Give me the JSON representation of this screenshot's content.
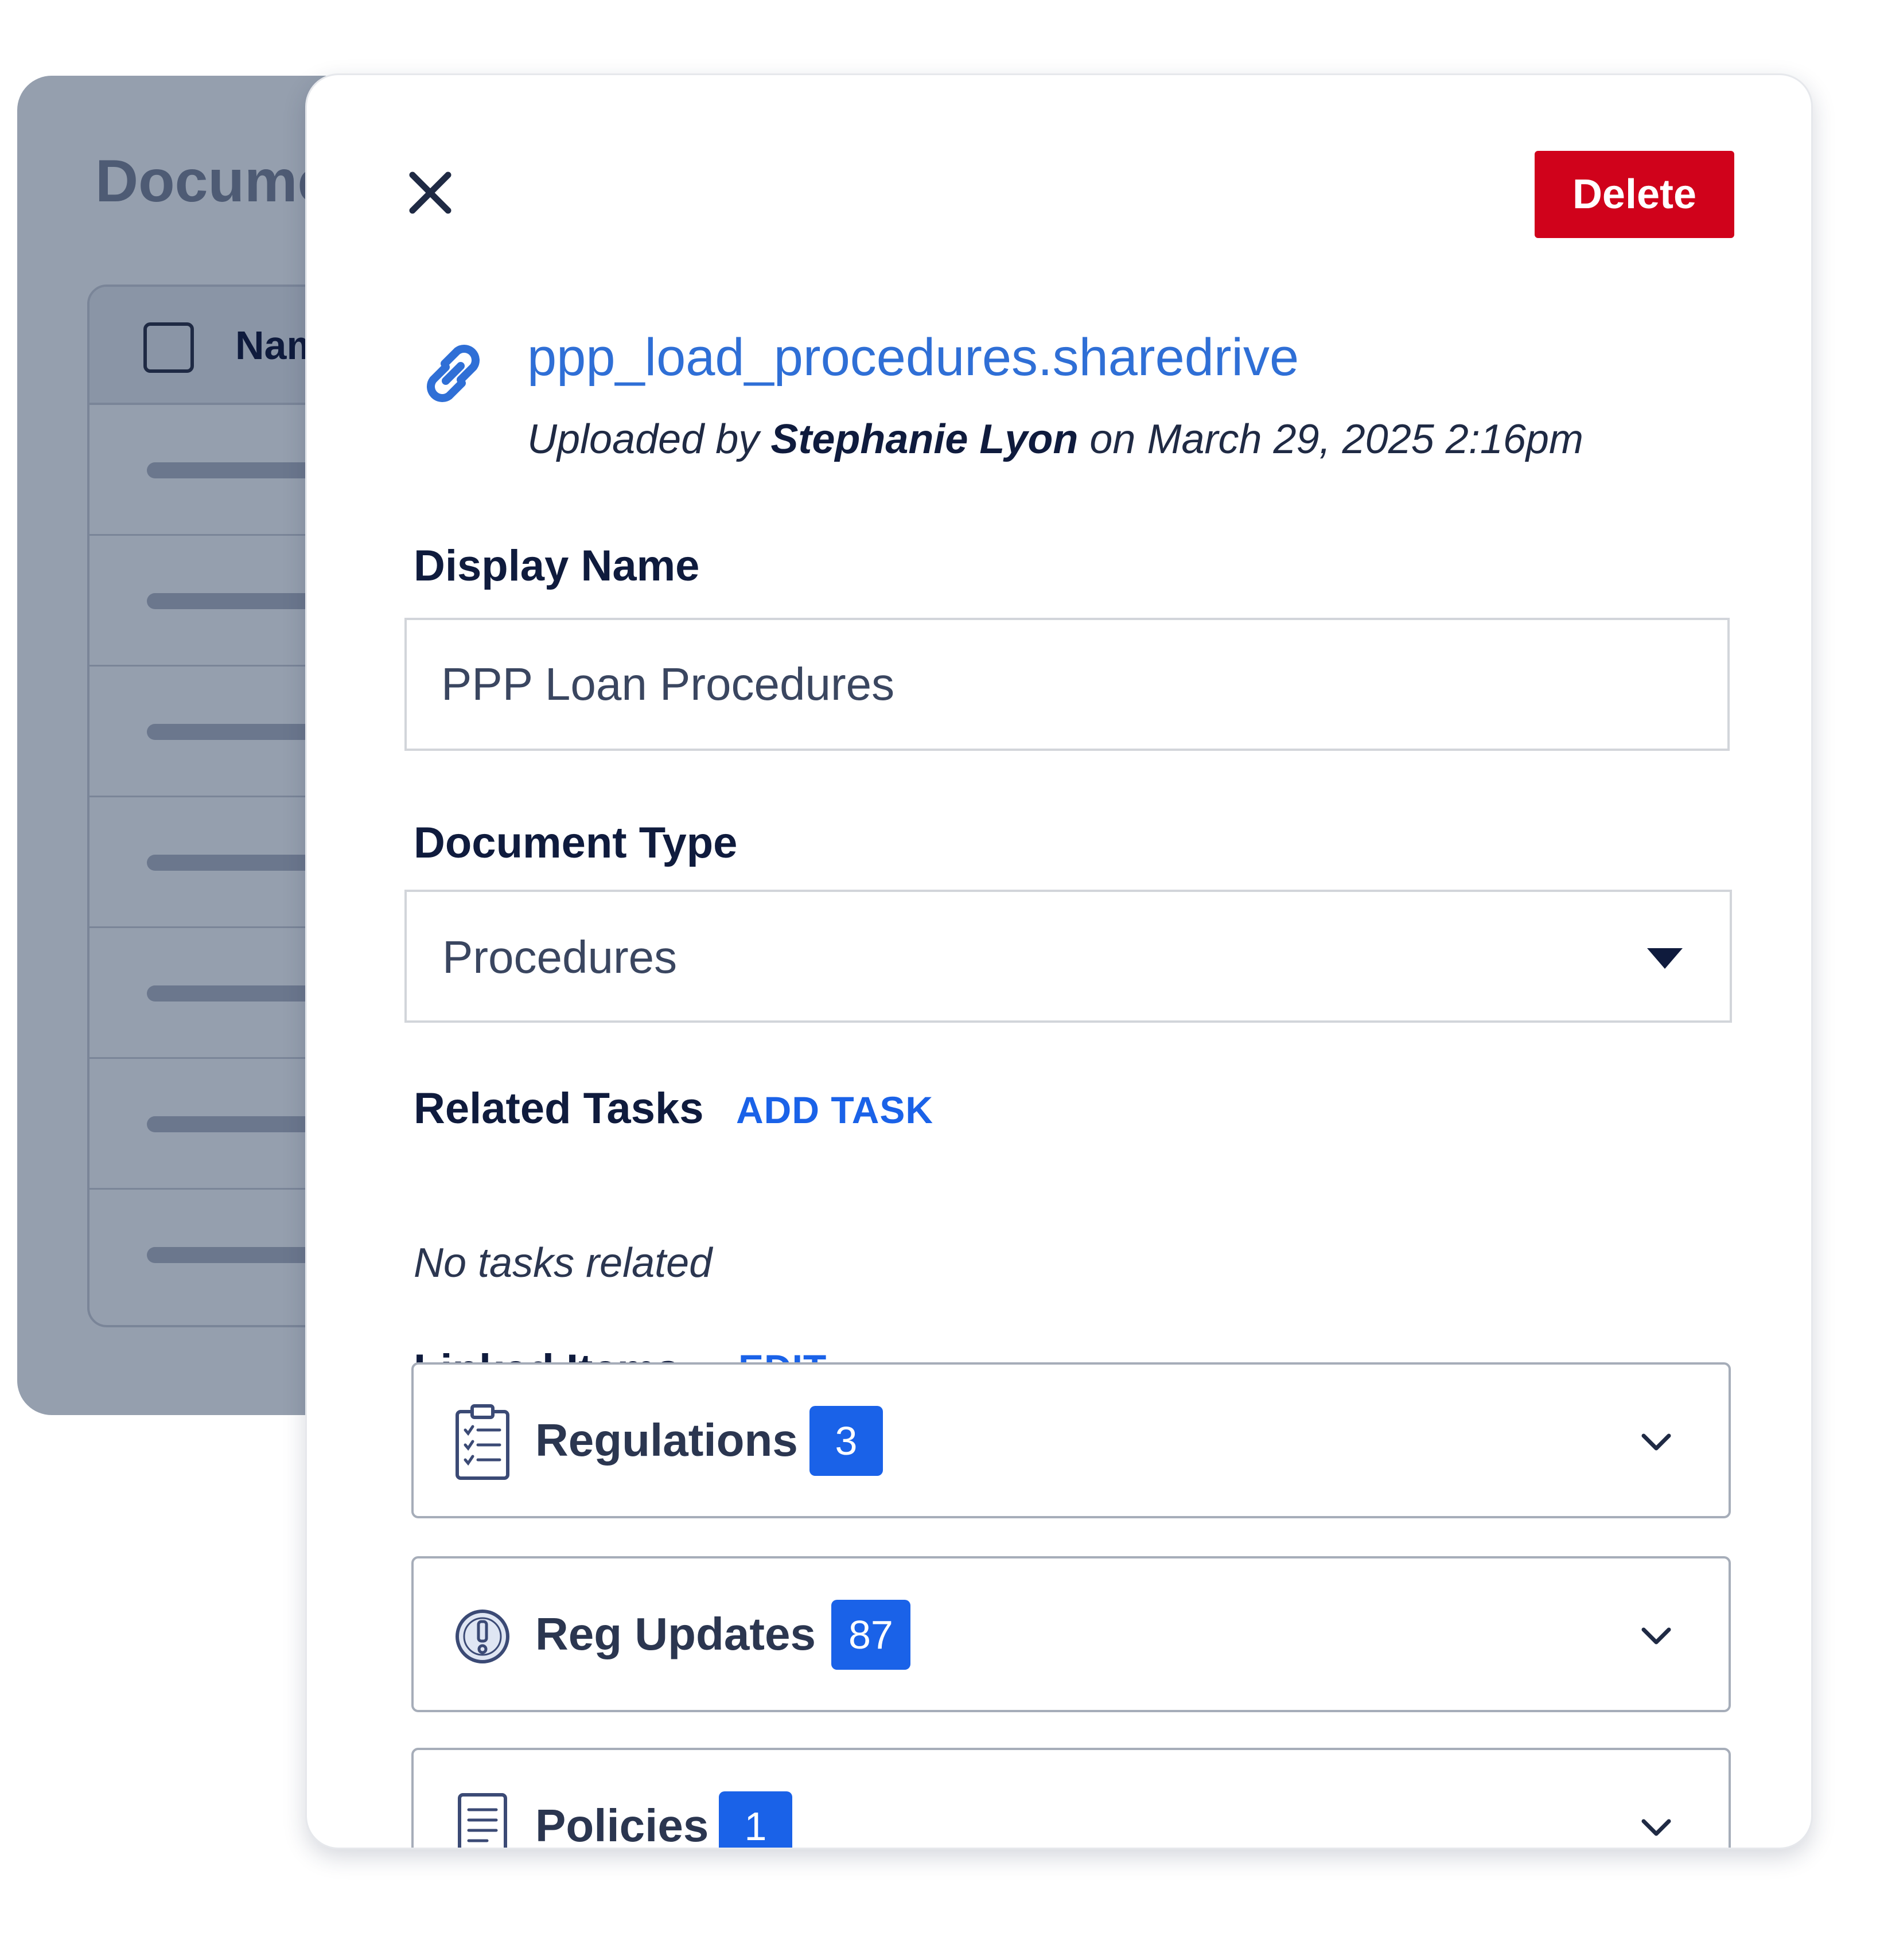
{
  "background": {
    "title": "Docume",
    "table_header": "Nam",
    "row_count": 7
  },
  "panel": {
    "delete_label": "Delete",
    "file": {
      "name": "ppp_load_procedures.sharedrive",
      "uploaded_prefix": "Uploaded by ",
      "uploaded_by": "Stephanie Lyon",
      "uploaded_suffix": " on March 29, 2025 2:16pm"
    },
    "display_name": {
      "label": "Display Name",
      "value": "PPP Loan Procedures"
    },
    "document_type": {
      "label": "Document Type",
      "value": "Procedures"
    },
    "related_tasks": {
      "label": "Related Tasks",
      "action": "ADD TASK",
      "empty_text": "No tasks related"
    },
    "linked_items": {
      "label": "Linked Items",
      "action": "EDIT",
      "groups": [
        {
          "label": "Regulations",
          "count": "3",
          "icon": "clipboard-checklist-icon"
        },
        {
          "label": "Reg Updates",
          "count": "87",
          "icon": "alert-badge-icon"
        },
        {
          "label": "Policies",
          "count": "1",
          "icon": "document-lines-icon"
        }
      ]
    }
  },
  "colors": {
    "accent": "#1a62e8",
    "link": "#2f6fd6",
    "danger": "#d0021b",
    "text_dark": "#0f1b3d",
    "overlay": "#959fae"
  }
}
